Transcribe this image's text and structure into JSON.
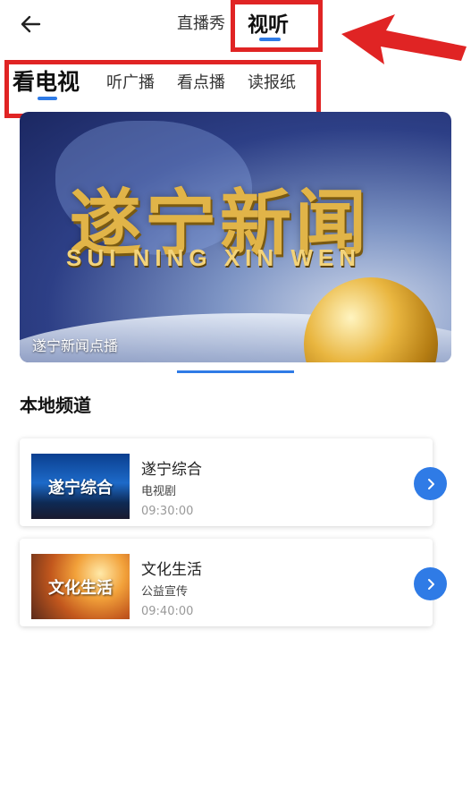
{
  "header": {
    "tabs": [
      {
        "label": "直播秀",
        "active": false
      },
      {
        "label": "视听",
        "active": true
      }
    ]
  },
  "subtabs": [
    {
      "label": "看电视",
      "active": true
    },
    {
      "label": "听广播",
      "active": false
    },
    {
      "label": "看点播",
      "active": false
    },
    {
      "label": "读报纸",
      "active": false
    }
  ],
  "banner": {
    "title_cn": "遂宁新闻",
    "title_en": "SUI NING XIN WEN",
    "caption": "遂宁新闻点播"
  },
  "section": {
    "title": "本地频道"
  },
  "channels": [
    {
      "thumb_text": "遂宁综合",
      "name": "遂宁综合",
      "type": "电视剧",
      "time": "09:30:00"
    },
    {
      "thumb_text": "文化生活",
      "name": "文化生活",
      "type": "公益宣传",
      "time": "09:40:00"
    }
  ],
  "colors": {
    "accent": "#2f7be6",
    "highlight": "#e02424"
  },
  "icons": {
    "back": "back-arrow-icon",
    "go": "chevron-right-icon"
  }
}
